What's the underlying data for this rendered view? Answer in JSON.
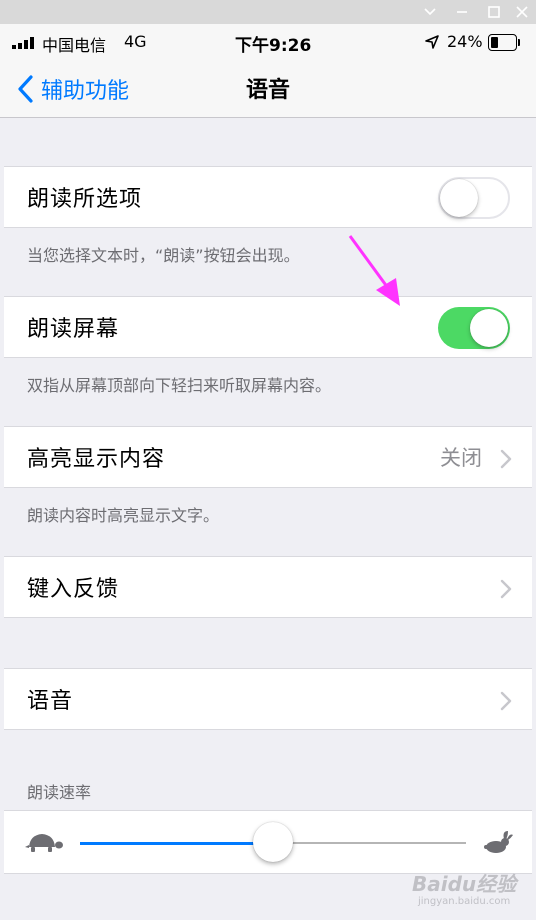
{
  "window": {
    "buttons": [
      "minimize",
      "maximize",
      "close"
    ]
  },
  "status": {
    "carrier": "中国电信",
    "network": "4G",
    "time": "下午9:26",
    "battery": "24%"
  },
  "nav": {
    "back_label": "辅助功能",
    "title": "语音"
  },
  "rows": {
    "speak_selection": {
      "label": "朗读所选项",
      "on": false,
      "footer": "当您选择文本时，“朗读”按钮会出现。"
    },
    "speak_screen": {
      "label": "朗读屏幕",
      "on": true,
      "footer": "双指从屏幕顶部向下轻扫来听取屏幕内容。"
    },
    "highlight": {
      "label": "高亮显示内容",
      "value": "关闭",
      "footer": "朗读内容时高亮显示文字。"
    },
    "typing_feedback": {
      "label": "键入反馈"
    },
    "voices": {
      "label": "语音"
    }
  },
  "speaking_rate": {
    "header": "朗读速率",
    "value": 0.5
  },
  "watermark": {
    "text": "Baidu经验",
    "sub": "jingyan.baidu.com"
  },
  "colors": {
    "accent": "#007aff",
    "switch_on": "#4cd964",
    "annotation_arrow": "#ff33ff"
  },
  "icons": [
    "signal-icon",
    "location-arrow-icon",
    "battery-icon",
    "back-chevron-icon",
    "chevron-right-icon",
    "turtle-icon",
    "rabbit-icon"
  ]
}
